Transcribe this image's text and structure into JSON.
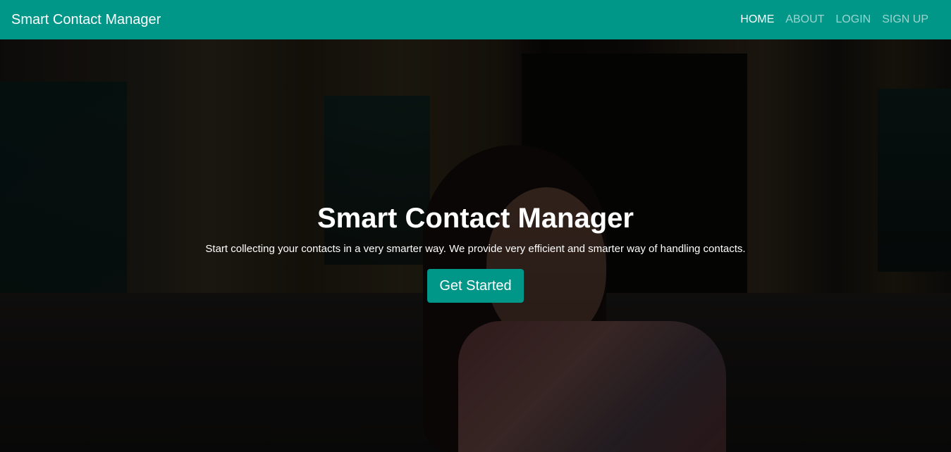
{
  "navbar": {
    "brand": "Smart Contact Manager",
    "links": [
      {
        "label": "HOME",
        "active": true
      },
      {
        "label": "ABOUT",
        "active": false
      },
      {
        "label": "LOGIN",
        "active": false
      },
      {
        "label": "SIGN UP",
        "active": false
      }
    ]
  },
  "hero": {
    "title": "Smart Contact Manager",
    "subtitle": "Start collecting your contacts in a very smarter way. We provide very efficient and smarter way of handling contacts.",
    "cta_label": "Get Started"
  },
  "colors": {
    "primary": "#009688",
    "text_light": "#ffffff"
  }
}
